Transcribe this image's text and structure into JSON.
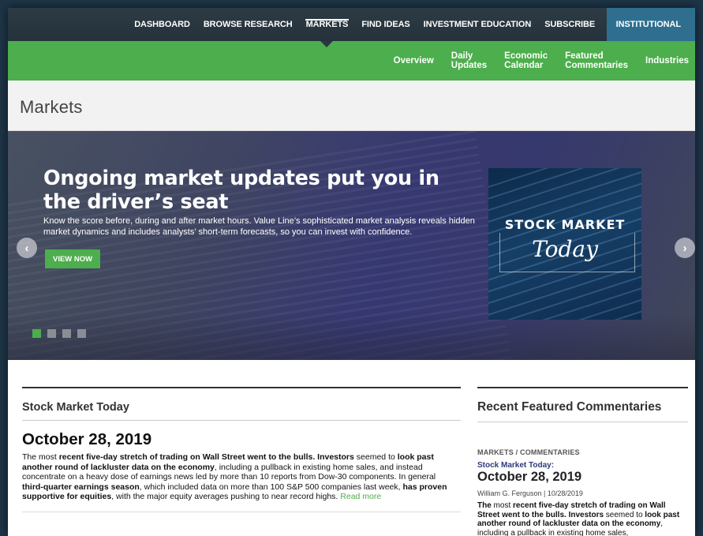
{
  "topnav": {
    "items": [
      "DASHBOARD",
      "BROWSE RESEARCH",
      "MARKETS",
      "FIND IDEAS",
      "INVESTMENT EDUCATION",
      "SUBSCRIBE"
    ],
    "institutional": "INSTITUTIONAL",
    "active": "MARKETS"
  },
  "subnav": {
    "items": [
      "Overview",
      "Daily\nUpdates",
      "Economic\nCalendar",
      "Featured\nCommentaries",
      "Industries"
    ]
  },
  "page": {
    "title": "Markets"
  },
  "hero": {
    "headline": "Ongoing market updates put you in the driver’s seat",
    "body": "Know the score before, during and after market hours.  Value Line’s sophisticated market analysis reveals hidden market dynamics and includes analysts’ short-term forecasts, so you can invest with confidence.",
    "cta": "VIEW NOW",
    "prev_icon": "‹",
    "next_icon": "›",
    "promo_line1": "STOCK MARKET",
    "promo_line2": "Today",
    "slides_count": 4,
    "active_slide": 1
  },
  "stock_market_today": {
    "section_title": "Stock Market Today",
    "date": "October 28, 2019",
    "read_more": "Read more"
  },
  "recent": {
    "section_title": "Recent Featured Commentaries",
    "kicker": "MARKETS / COMMENTARIES",
    "subhead": "Stock Market Today:",
    "date": "October 28, 2019",
    "byline": "William G. Ferguson | 10/28/2019"
  },
  "colors": {
    "green": "#4cae4c",
    "nav_dark": "#2d3b44",
    "institutional": "#2e6f90"
  }
}
